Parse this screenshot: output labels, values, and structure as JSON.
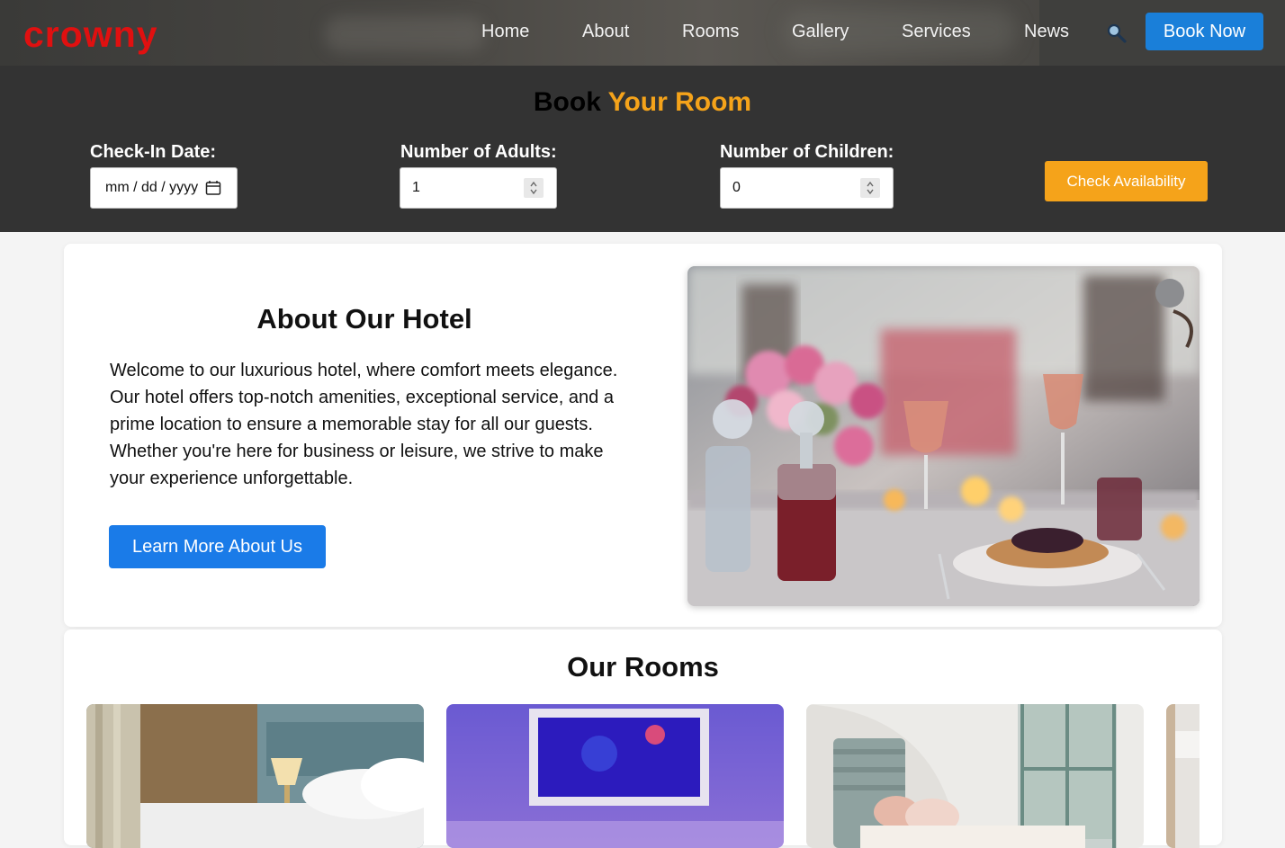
{
  "nav": {
    "logo": "crowny",
    "links": [
      "Home",
      "About",
      "Rooms",
      "Gallery",
      "Services",
      "News"
    ],
    "search_icon": "magnifier-icon",
    "book_now": "Book Now"
  },
  "booking": {
    "title_part1": "Book",
    "title_part2": "Your Room",
    "checkin_label": "Check-In Date:",
    "checkin_placeholder": "mm / dd / yyyy",
    "adults_label": "Number of Adults:",
    "adults_value": "1",
    "children_label": "Number of Children:",
    "children_value": "0",
    "check_button": "Check Availability"
  },
  "about": {
    "title": "About Our Hotel",
    "text": "Welcome to our luxurious hotel, where comfort meets elegance. Our hotel offers top-notch amenities, exceptional service, and a prime location to ensure a memorable stay for all our guests. Whether you're here for business or leisure, we strive to make your experience unforgettable.",
    "button": "Learn More About Us"
  },
  "rooms": {
    "title": "Our Rooms"
  },
  "colors": {
    "logo": "#e01010",
    "accent_orange": "#f5a31a",
    "primary_blue": "#1a7fd9",
    "booking_bg": "#333333"
  }
}
